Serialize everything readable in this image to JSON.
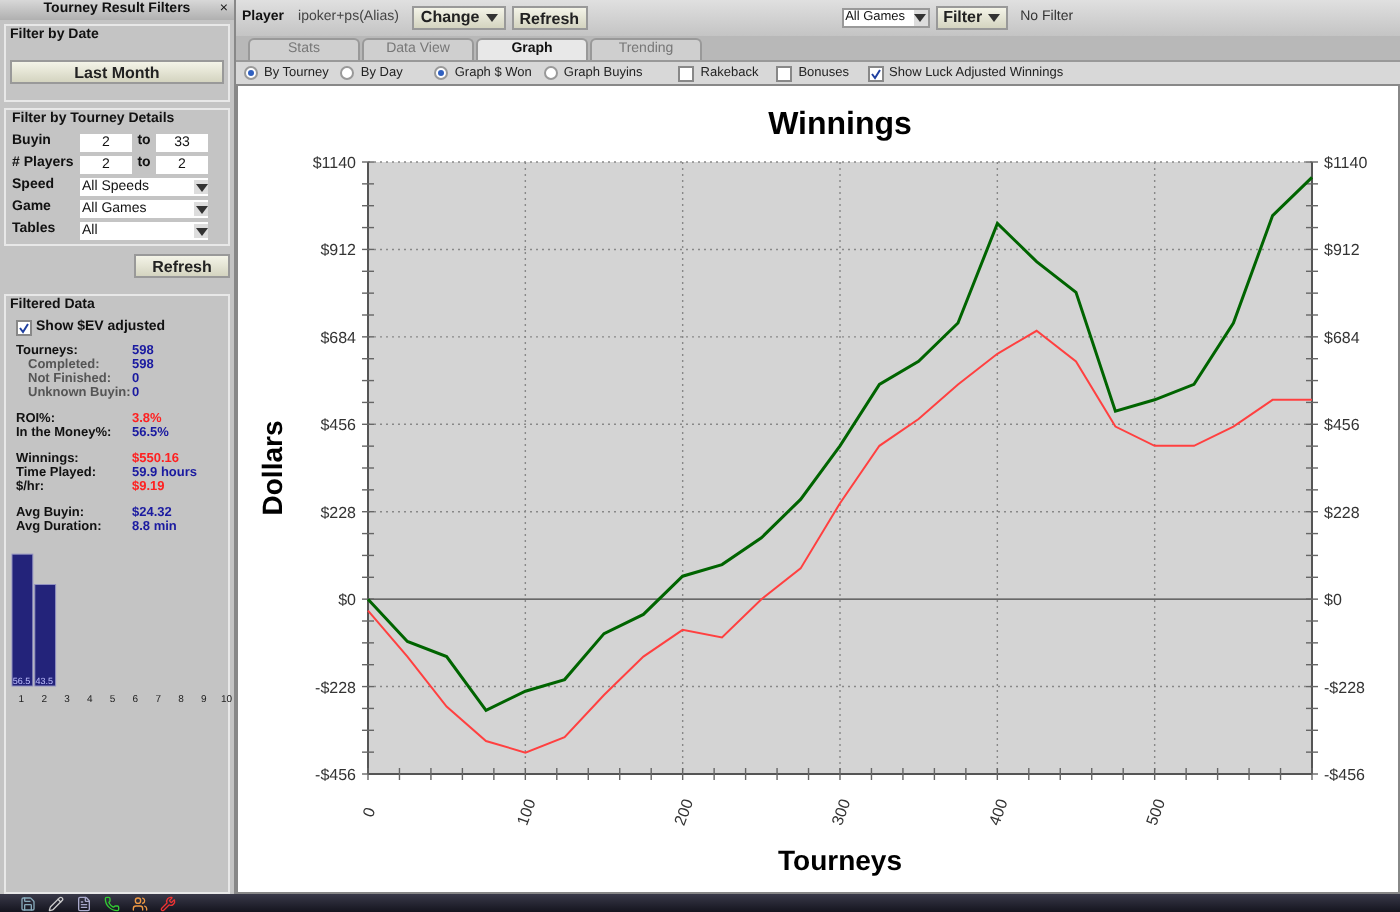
{
  "sidebar": {
    "title": "Tourney Result Filters",
    "close": "×",
    "date_filter": {
      "heading": "Filter by Date",
      "button": "Last Month"
    },
    "details_filter": {
      "heading": "Filter by Tourney Details",
      "ranges": [
        {
          "label": "Buyin",
          "from": "2",
          "to_label": "to",
          "to": "33"
        },
        {
          "label": "# Players",
          "from": "2",
          "to_label": "to",
          "to": "2"
        }
      ],
      "selects": [
        {
          "label": "Speed",
          "value": "All Speeds"
        },
        {
          "label": "Game",
          "value": "All Games"
        },
        {
          "label": "Tables",
          "value": "All"
        }
      ]
    },
    "refresh": "Refresh",
    "filtered": {
      "heading": "Filtered Data",
      "ev_checkbox": {
        "label": "Show $EV adjusted",
        "checked": true
      },
      "groups": [
        [
          {
            "label": "Tourneys:",
            "value": "598",
            "sub": false,
            "color": "#1a1aa0"
          },
          {
            "label": "Completed:",
            "value": "598",
            "sub": true,
            "color": "#1a1aa0"
          },
          {
            "label": "Not Finished:",
            "value": "0",
            "sub": true,
            "color": "#1a1aa0"
          },
          {
            "label": "Unknown Buyin:",
            "value": "0",
            "sub": true,
            "color": "#1a1aa0"
          }
        ],
        [
          {
            "label": "ROI%:",
            "value": "3.8%",
            "sub": false,
            "color": "#ff2020"
          },
          {
            "label": "In the Money%:",
            "value": "56.5%",
            "sub": false,
            "color": "#1a1aa0"
          }
        ],
        [
          {
            "label": "Winnings:",
            "value": "$550.16",
            "sub": false,
            "color": "#ff2020"
          },
          {
            "label": "Time Played:",
            "value": "59.9 hours",
            "sub": false,
            "color": "#1a1aa0"
          },
          {
            "label": "$/hr:",
            "value": "$9.19",
            "sub": false,
            "color": "#ff2020"
          }
        ],
        [
          {
            "label": "Avg Buyin:",
            "value": "$24.32",
            "sub": false,
            "color": "#1a1aa0"
          },
          {
            "label": "Avg Duration:",
            "value": "8.8 min",
            "sub": false,
            "color": "#1a1aa0"
          }
        ]
      ]
    },
    "histogram": {
      "chart_data": {
        "type": "bar",
        "categories": [
          "1",
          "2",
          "3",
          "4",
          "5",
          "6",
          "7",
          "8",
          "9",
          "10"
        ],
        "values": [
          56.5,
          43.5,
          0,
          0,
          0,
          0,
          0,
          0,
          0,
          0
        ],
        "value_labels": [
          "56.5",
          "43.5",
          null,
          null,
          null,
          null,
          null,
          null,
          null,
          null
        ]
      }
    }
  },
  "toolbar": {
    "player_label": "Player",
    "player": "ipoker+ps(Alias)",
    "change": "Change",
    "refresh": "Refresh",
    "games": "All Games",
    "filter": "Filter",
    "filter_status": "No Filter"
  },
  "tabs": [
    {
      "label": "Stats",
      "selected": false
    },
    {
      "label": "Data View",
      "selected": false
    },
    {
      "label": "Graph",
      "selected": true
    },
    {
      "label": "Trending",
      "selected": false
    }
  ],
  "options": {
    "radios": [
      [
        {
          "label": "By Tourney",
          "selected": true
        },
        {
          "label": "By Day",
          "selected": false
        }
      ],
      [
        {
          "label": "Graph $ Won",
          "selected": true
        },
        {
          "label": "Graph Buyins",
          "selected": false
        }
      ]
    ],
    "checkboxes": [
      {
        "label": "Rakeback",
        "checked": false
      },
      {
        "label": "Bonuses",
        "checked": false
      },
      {
        "label": "Show Luck Adjusted Winnings",
        "checked": true
      }
    ]
  },
  "chart": {
    "chart_data": {
      "type": "line",
      "title": "Winnings",
      "xlabel": "Tourneys",
      "ylabel": "Dollars",
      "x": [
        0,
        25,
        50,
        75,
        100,
        125,
        150,
        175,
        200,
        225,
        250,
        275,
        300,
        325,
        350,
        375,
        400,
        425,
        450,
        475,
        500,
        525,
        550,
        575,
        600
      ],
      "series": [
        {
          "color": "#006400",
          "values": [
            0,
            -110,
            -150,
            -290,
            -240,
            -210,
            -90,
            -40,
            60,
            90,
            160,
            260,
            400,
            560,
            620,
            720,
            980,
            880,
            800,
            490,
            520,
            560,
            720,
            1000,
            1100
          ]
        },
        {
          "color": "#ff4040",
          "values": [
            -30,
            -150,
            -280,
            -370,
            -400,
            -360,
            -250,
            -150,
            -80,
            -100,
            0,
            80,
            250,
            400,
            470,
            560,
            640,
            700,
            620,
            450,
            400,
            400,
            450,
            520,
            520
          ]
        }
      ],
      "grid": true,
      "xlim": [
        0,
        600
      ],
      "ylim": [
        -456,
        1140
      ],
      "xticks": [
        0,
        100,
        200,
        300,
        400,
        500
      ],
      "yticks": [
        {
          "value": -456,
          "label": "-$456"
        },
        {
          "value": -228,
          "label": "-$228"
        },
        {
          "value": 0,
          "label": "$0"
        },
        {
          "value": 228,
          "label": "$228"
        },
        {
          "value": 456,
          "label": "$456"
        },
        {
          "value": 684,
          "label": "$684"
        },
        {
          "value": 912,
          "label": "$912"
        },
        {
          "value": 1140,
          "label": "$1140"
        }
      ]
    }
  }
}
